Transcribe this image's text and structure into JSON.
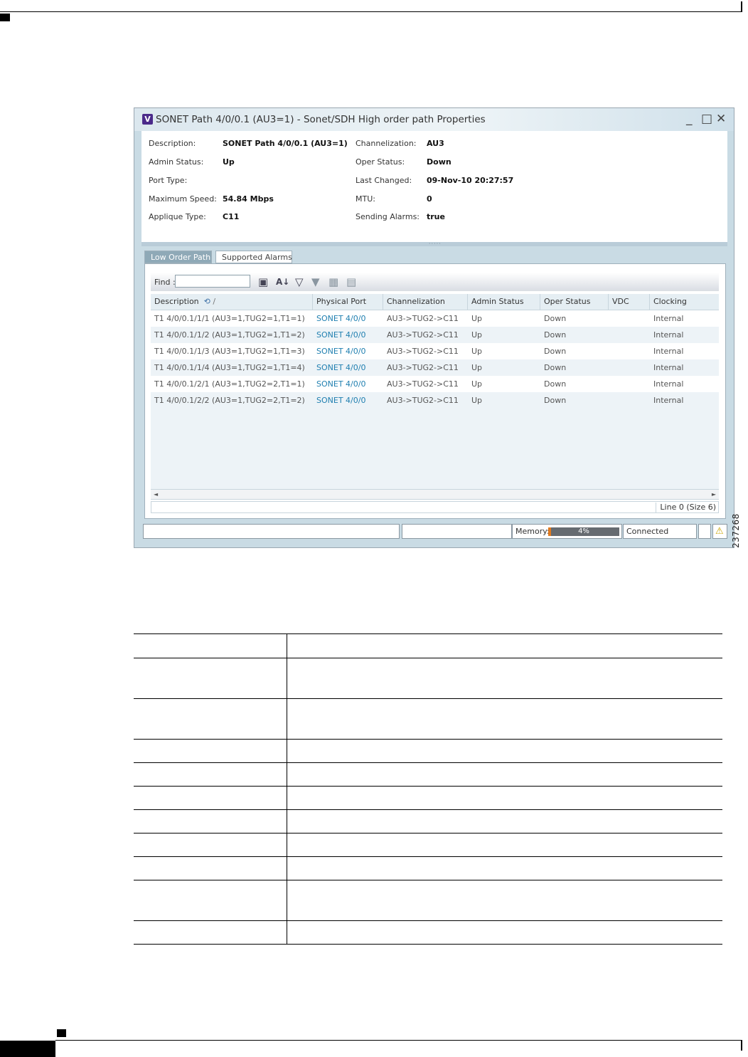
{
  "figure_id": "237268",
  "window": {
    "app_icon_letter": "V",
    "title": "SONET Path 4/0/0.1 (AU3=1) - Sonet/SDH High order path Properties",
    "minimize_glyph": "_",
    "maximize_glyph": "□",
    "close_glyph": "✕"
  },
  "properties": {
    "description_label": "Description:",
    "description_value": "SONET Path 4/0/0.1 (AU3=1)",
    "admin_status_label": "Admin Status:",
    "admin_status_value": "Up",
    "port_type_label": "Port Type:",
    "port_type_value": "",
    "max_speed_label": "Maximum Speed:",
    "max_speed_value": "54.84 Mbps",
    "applique_label": "Applique Type:",
    "applique_value": "C11",
    "channelization_label": "Channelization:",
    "channelization_value": "AU3",
    "oper_status_label": "Oper Status:",
    "oper_status_value": "Down",
    "last_changed_label": "Last Changed:",
    "last_changed_value": "09-Nov-10 20:27:57",
    "mtu_label": "MTU:",
    "mtu_value": "0",
    "sending_alarms_label": "Sending Alarms:",
    "sending_alarms_value": "true"
  },
  "tabs": {
    "low_order_path": "Low Order Path",
    "supported_alarms": "Supported Alarms"
  },
  "toolbar": {
    "find_label": "Find :",
    "find_value": "",
    "icons": [
      "save-icon",
      "sort-icon",
      "filter-icon",
      "filter-edit-icon",
      "export-icon",
      "print-icon"
    ]
  },
  "grid": {
    "columns": [
      "Description",
      "Physical Port",
      "Channelization",
      "Admin Status",
      "Oper Status",
      "VDC",
      "Clocking"
    ],
    "rows": [
      [
        "T1 4/0/0.1/1/1 (AU3=1,TUG2=1,T1=1)",
        "SONET 4/0/0",
        "AU3->TUG2->C11",
        "Up",
        "Down",
        "",
        "Internal"
      ],
      [
        "T1 4/0/0.1/1/2 (AU3=1,TUG2=1,T1=2)",
        "SONET 4/0/0",
        "AU3->TUG2->C11",
        "Up",
        "Down",
        "",
        "Internal"
      ],
      [
        "T1 4/0/0.1/1/3 (AU3=1,TUG2=1,T1=3)",
        "SONET 4/0/0",
        "AU3->TUG2->C11",
        "Up",
        "Down",
        "",
        "Internal"
      ],
      [
        "T1 4/0/0.1/1/4 (AU3=1,TUG2=1,T1=4)",
        "SONET 4/0/0",
        "AU3->TUG2->C11",
        "Up",
        "Down",
        "",
        "Internal"
      ],
      [
        "T1 4/0/0.1/2/1 (AU3=1,TUG2=2,T1=1)",
        "SONET 4/0/0",
        "AU3->TUG2->C11",
        "Up",
        "Down",
        "",
        "Internal"
      ],
      [
        "T1 4/0/0.1/2/2 (AU3=1,TUG2=2,T1=2)",
        "SONET 4/0/0",
        "AU3->TUG2->C11",
        "Up",
        "Down",
        "",
        "Internal"
      ]
    ],
    "line_status": "Line 0 (Size 6)"
  },
  "statusbar": {
    "memory_label": "Memory:",
    "memory_text": "4%",
    "memory_fraction": 0.04,
    "connection": "Connected",
    "accent_color": "#e07a1f"
  },
  "bottom_table": {
    "row_count": 11,
    "cells": []
  }
}
